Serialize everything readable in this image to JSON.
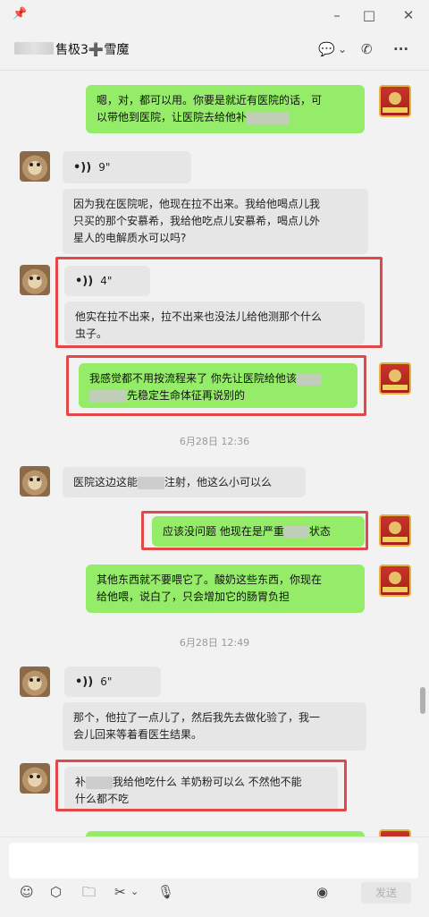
{
  "window": {
    "title": "售极3➕雪魔",
    "buttons": {
      "minimize": "–",
      "maximize": "□",
      "close": "✕"
    }
  },
  "header": {
    "chat_icon": "💬",
    "chevron": "⌄",
    "call_icon": "✆",
    "more": "···"
  },
  "messages": [
    {
      "side": "out",
      "text_a": "嗯，对，都可以用。你要是就近有医院的话，可",
      "text_b": "以带他到医院，让医院去给他补"
    },
    {
      "side": "in",
      "voice": "9\""
    },
    {
      "side": "in",
      "text_a": "因为我在医院呢，他现在拉不出来。我给他喝点儿我",
      "text_b": "只买的那个安慕希，我给他吃点儿安慕希，喝点儿外",
      "text_c": "星人的电解质水可以吗?"
    },
    {
      "side": "in",
      "voice": "4\""
    },
    {
      "side": "in",
      "text_a": "他实在拉不出来，拉不出来也没法儿给他测那个什么",
      "text_b": "虫子。"
    },
    {
      "side": "out",
      "text_a": "我感觉都不用按流程来了 你先让医院给他该",
      "text_b": "先稳定生命体征再说别的"
    },
    {
      "side": "time",
      "text": "6月28日 12:36"
    },
    {
      "side": "in",
      "text_a": "医院这边这能",
      "text_b": "注射，他这么小可以么"
    },
    {
      "side": "out",
      "text_a": "应该没问题 他现在是严重",
      "text_b": "状态"
    },
    {
      "side": "out",
      "text_a": "其他东西就不要喂它了。酸奶这些东西，你现在",
      "text_b": "给他喂，说白了，只会增加它的肠胃负担"
    },
    {
      "side": "time",
      "text": "6月28日 12:49"
    },
    {
      "side": "in",
      "voice": "6\""
    },
    {
      "side": "in",
      "text_a": "那个，他拉了一点儿了，然后我先去做化验了，我一",
      "text_b": "会儿回来等着看医生结果。"
    },
    {
      "side": "in",
      "text_a": "补",
      "text_b": "我给他吃什么 羊奶粉可以么 不然他不能",
      "text_c": "什么都不吃"
    }
  ],
  "toolbar": {
    "emoji": "☺",
    "box": "⬡",
    "folder": "🗀",
    "scissors": "✂",
    "scissors_chevron": "⌄",
    "mic": "🎙",
    "voice_call": "◉",
    "send_label": "发送"
  },
  "colors": {
    "outgoing": "#95ec69",
    "incoming": "#e6e6e6",
    "highlight": "#e2474a"
  }
}
